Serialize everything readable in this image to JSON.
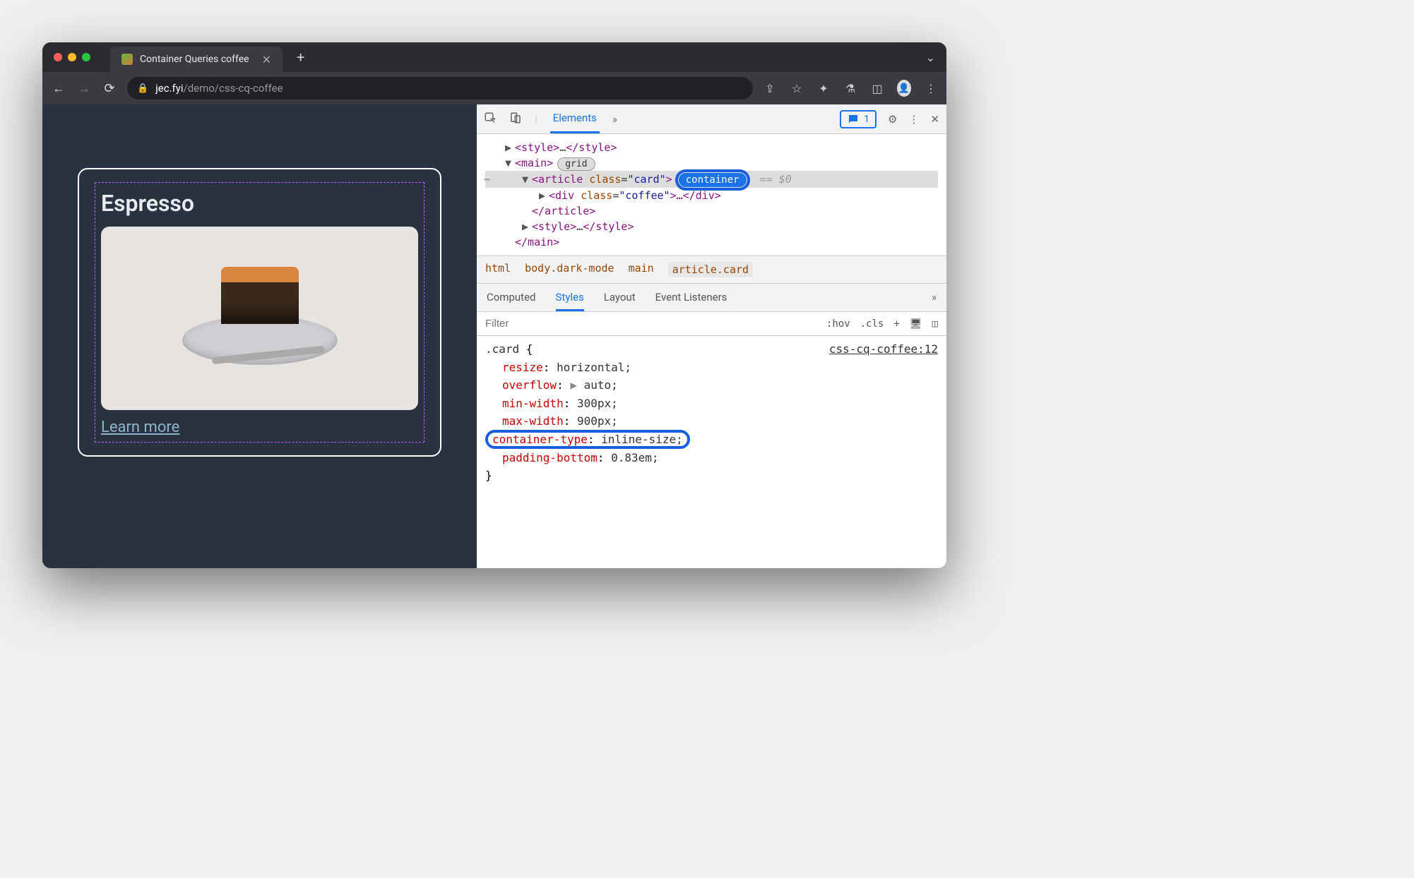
{
  "tab": {
    "title": "Container Queries coffee"
  },
  "url": {
    "host": "jec.fyi",
    "path": "/demo/css-cq-coffee"
  },
  "page": {
    "card_title": "Espresso",
    "learn_more": "Learn more"
  },
  "devtools": {
    "main_tab": "Elements",
    "issues_count": "1",
    "dom": {
      "style_open": "<style>",
      "style_ellipsis": "…",
      "style_close": "</style>",
      "main_open": "<main>",
      "grid_badge": "grid",
      "article_open_1": "<article ",
      "article_class_attr": "class",
      "article_class_val": "\"card\"",
      "article_open_2": ">",
      "container_badge": "container",
      "eq0": "== $0",
      "div_open_1": "<div ",
      "div_class_attr": "class",
      "div_class_val": "\"coffee\"",
      "div_rest": ">…</div>",
      "article_close": "</article>",
      "style2_open": "<style>",
      "style2_ellipsis": "…",
      "style2_close": "</style>",
      "main_close": "</main>"
    },
    "breadcrumbs": [
      "html",
      "body.dark-mode",
      "main",
      "article.card"
    ],
    "styles_tabs": [
      "Computed",
      "Styles",
      "Layout",
      "Event Listeners"
    ],
    "filter_placeholder": "Filter",
    "filter_btns": {
      "hov": ":hov",
      "cls": ".cls",
      "plus": "+"
    },
    "css": {
      "selector": ".card",
      "open_brace": " {",
      "source": "css-cq-coffee:12",
      "rules": [
        {
          "prop": "resize",
          "val": "horizontal;"
        },
        {
          "prop": "overflow",
          "val": "auto;",
          "shorthand": true
        },
        {
          "prop": "min-width",
          "val": "300px;"
        },
        {
          "prop": "max-width",
          "val": "900px;"
        },
        {
          "prop": "container-type",
          "val": "inline-size;",
          "highlight": true
        },
        {
          "prop": "padding-bottom",
          "val": "0.83em;"
        }
      ],
      "close_brace": "}"
    }
  }
}
